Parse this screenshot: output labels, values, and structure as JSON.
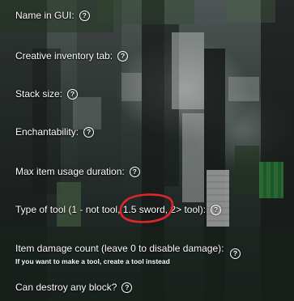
{
  "form": {
    "fields": [
      {
        "label": "Name in GUI:",
        "help_icon": "?"
      },
      {
        "label": "Creative inventory tab:",
        "help_icon": "?"
      },
      {
        "label": "Stack size:",
        "help_icon": "?"
      },
      {
        "label": "Enchantability:",
        "help_icon": "?"
      },
      {
        "label": "Max item usage duration:",
        "help_icon": "?"
      },
      {
        "label": "Type of tool (1 - not tool, 1.5 sword, 2> tool):",
        "help_icon": "?"
      },
      {
        "label": "Item damage count (leave 0 to disable damage):",
        "sub_note": "If you want to make a tool, create a tool instead",
        "help_icon": "?"
      },
      {
        "label": "Can destroy any block?",
        "help_icon": "?"
      }
    ]
  },
  "annotation": {
    "shape": "ellipse",
    "color": "#e0262b"
  },
  "colors": {
    "label_text": "#ffffff",
    "annotation_red": "#e0262b"
  }
}
